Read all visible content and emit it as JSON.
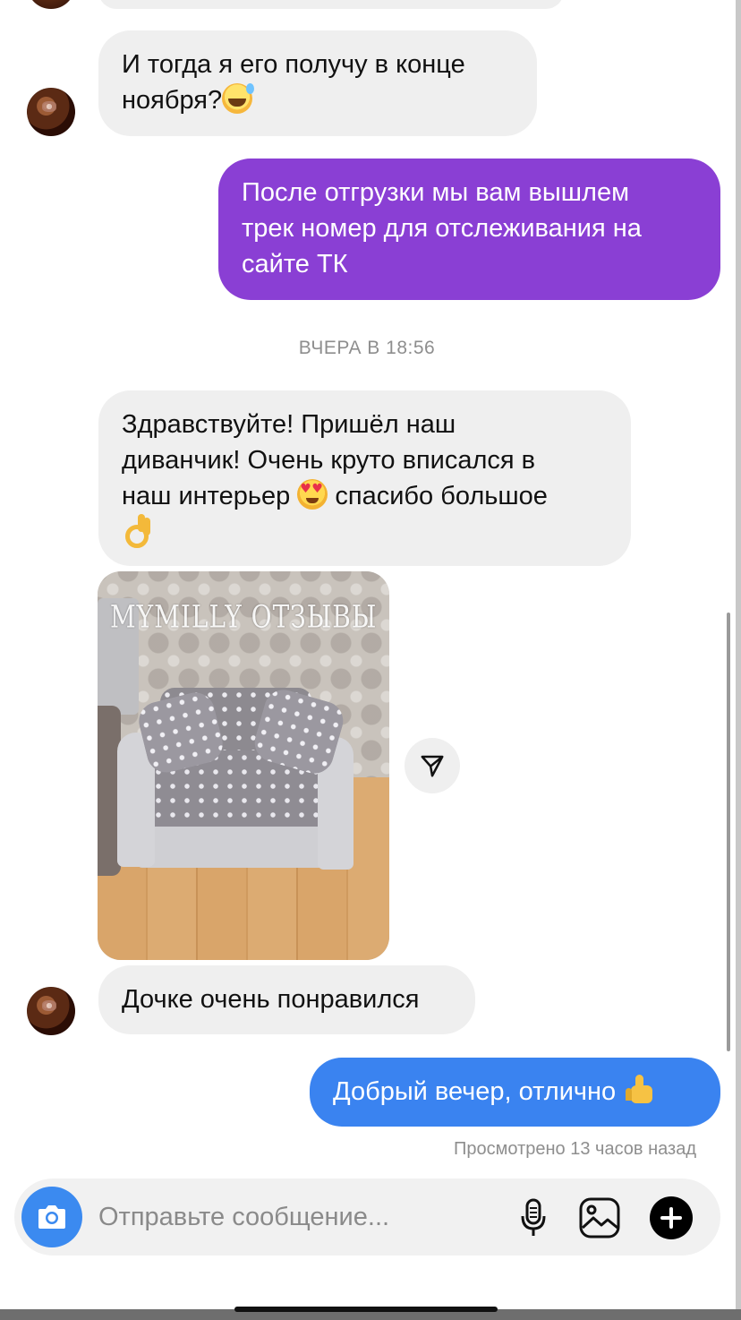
{
  "messages": {
    "m1_line1": "И тогда я его получу в конце",
    "m1_line2": "ноября?",
    "m2_line1": "После отгрузки мы вам вышлем",
    "m2_line2": "трек номер для отслеживания на",
    "m2_line3": "сайте ТК",
    "timestamp": "ВЧЕРА В 18:56",
    "m3_line1": "Здравствуйте! Пришёл наш",
    "m3_line2": "диванчик! Очень круто вписался в",
    "m3_line3a": "наш интерьер",
    "m3_line3b": "спасибо большое",
    "photo_watermark": "MYMILLY ОТЗЫВЫ",
    "m4": "Дочке очень понравился",
    "m5": "Добрый вечер, отлично"
  },
  "status": {
    "seen": "Просмотрено 13 часов назад"
  },
  "composer": {
    "placeholder": "Отправьте сообщение..."
  },
  "colors": {
    "incoming_bubble": "#efefef",
    "outgoing_purple": "#8a3fd4",
    "outgoing_blue": "#3a83f0",
    "camera_button": "#3b8af0"
  },
  "icons": {
    "camera": "camera-icon",
    "mic": "microphone-icon",
    "gallery": "gallery-icon",
    "plus": "plus-icon",
    "share": "send-icon"
  }
}
